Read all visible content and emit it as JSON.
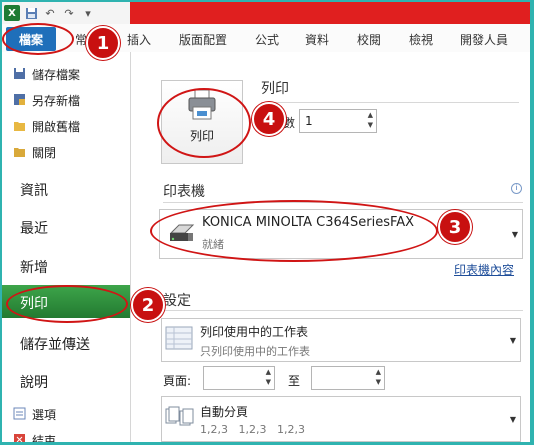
{
  "qat": {
    "app_icon": "X",
    "save_icon": "save-icon",
    "undo_icon": "undo-icon",
    "redo_icon": "redo-icon"
  },
  "ribbon": {
    "file_tab": "檔案",
    "tabs": [
      "常",
      "插入",
      "版面配置",
      "公式",
      "資料",
      "校閱",
      "檢視",
      "開發人員"
    ]
  },
  "nav": {
    "small_items": [
      "儲存檔案",
      "另存新檔",
      "開啟舊檔",
      "關閉"
    ],
    "big_items": [
      "資訊",
      "最近",
      "新增",
      "列印",
      "儲存並傳送",
      "說明"
    ],
    "bottom_items": [
      "選項",
      "結束"
    ],
    "selected": "列印"
  },
  "print": {
    "section_title": "列印",
    "button_label": "列印",
    "copies_label": "數",
    "copies_value": "1"
  },
  "printer": {
    "section_title": "印表機",
    "name": "KONICA MINOLTA C364SeriesFAX",
    "status": "就緒",
    "properties_link": "印表機內容"
  },
  "settings": {
    "section_title": "設定",
    "scope_title": "列印使用中的工作表",
    "scope_sub": "只列印使用中的工作表",
    "pages_label": "頁面:",
    "pages_to": "至",
    "pages_from_value": "",
    "pages_to_value": "",
    "collate_title": "自動分頁",
    "collate_sub": "1,2,3   1,2,3   1,2,3"
  },
  "callouts": [
    "1",
    "2",
    "3",
    "4"
  ],
  "colors": {
    "accent_red": "#c81010",
    "file_tab": "#1f6fba",
    "nav_selected": "#2f9a3f",
    "frame": "#2fb3b0"
  }
}
